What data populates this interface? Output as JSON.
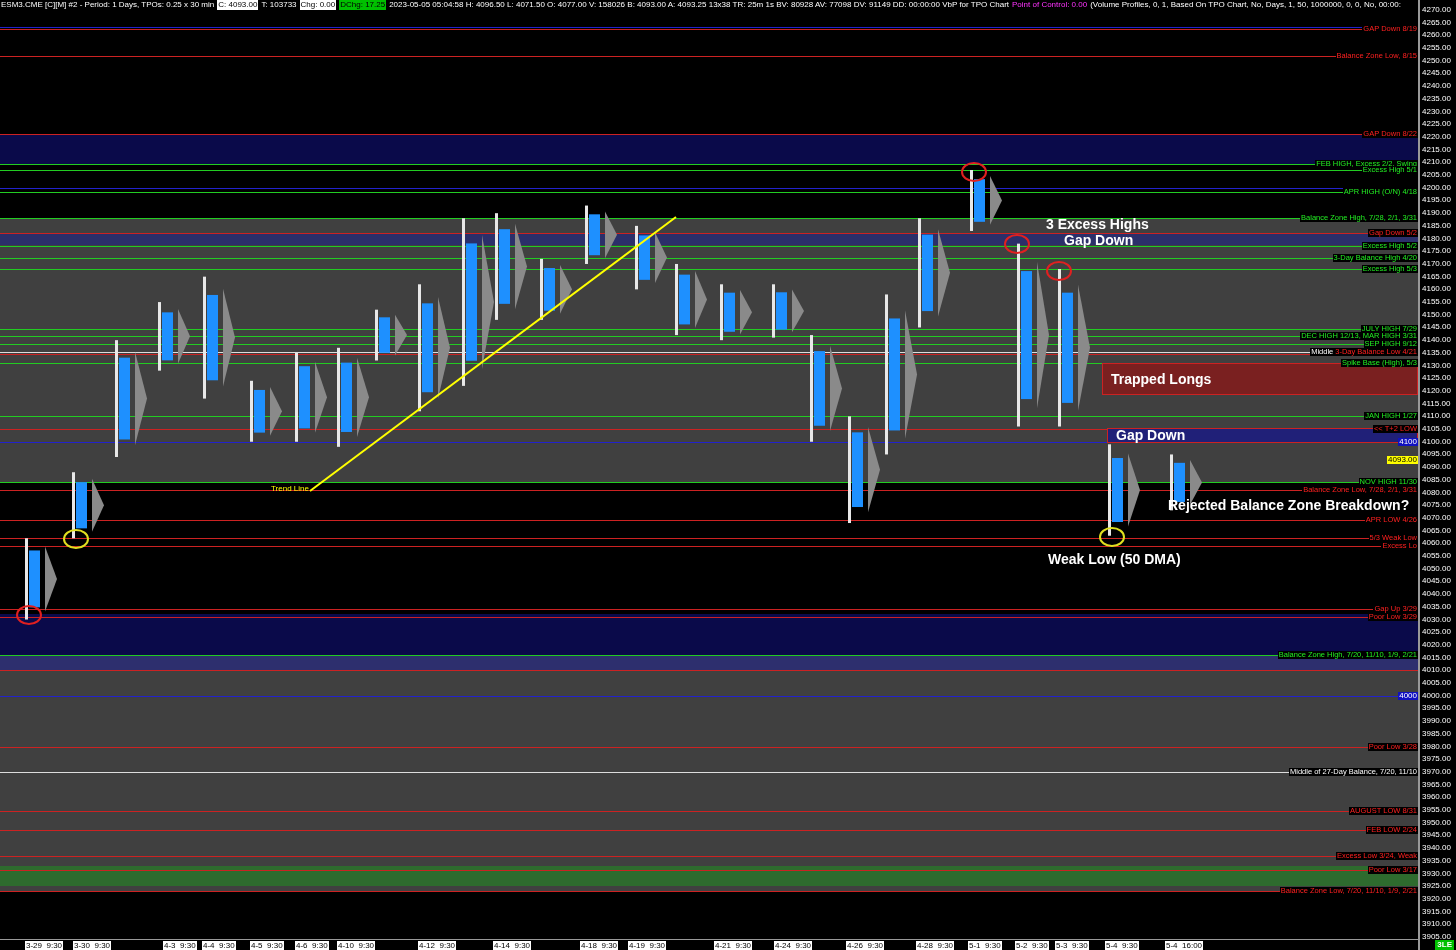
{
  "header": [
    {
      "kind": "plain",
      "text": "ESM3.CME [C][M]  #2 - Period: 1 Days, TPOs: 0.25 x 30 min"
    },
    {
      "kind": "inverse",
      "text": "C: 4093.00"
    },
    {
      "kind": "plain",
      "text": "T: 103733"
    },
    {
      "kind": "inverse",
      "text": "Chg: 0.00"
    },
    {
      "kind": "up",
      "text": "DChg: 17.25"
    },
    {
      "kind": "plain",
      "text": "2023-05-05 05:04:58 H: 4096.50 L: 4071.50 O: 4077.00 V: 158026 B: 4093.00 A: 4093.25 13x38 TR: 25m 1s BV: 80928 AV: 77098 DV: 91149 DD: 00:00:00 VbP for TPO Chart"
    },
    {
      "kind": "study",
      "text": "Point of Control: 0.00"
    },
    {
      "kind": "plain",
      "text": "(Volume Profiles, 0, 1, Based On TPO Chart, No, Days, 1, 50, 1000000, 0, 0, No, 00:00:"
    }
  ],
  "chart": {
    "price_axis": [
      "4270.00",
      "4265.00",
      "4260.00",
      "4255.00",
      "4250.00",
      "4245.00",
      "4240.00",
      "4235.00",
      "4230.00",
      "4225.00",
      "4220.00",
      "4215.00",
      "4210.00",
      "4205.00",
      "4200.00",
      "4195.00",
      "4190.00",
      "4185.00",
      "4180.00",
      "4175.00",
      "4170.00",
      "4165.00",
      "4160.00",
      "4155.00",
      "4150.00",
      "4145.00",
      "4140.00",
      "4135.00",
      "4130.00",
      "4125.00",
      "4120.00",
      "4115.00",
      "4110.00",
      "4105.00",
      "4100.00",
      "4095.00",
      "4090.00",
      "4085.00",
      "4080.00",
      "4075.00",
      "4070.00",
      "4065.00",
      "4060.00",
      "4055.00",
      "4050.00",
      "4045.00",
      "4040.00",
      "4035.00",
      "4030.00",
      "4025.00",
      "4020.00",
      "4015.00",
      "4010.00",
      "4005.00",
      "4000.00",
      "3995.00",
      "3990.00",
      "3985.00",
      "3980.00",
      "3975.00",
      "3970.00",
      "3965.00",
      "3960.00",
      "3955.00",
      "3950.00",
      "3945.00",
      "3940.00",
      "3935.00",
      "3930.00",
      "3925.00",
      "3920.00",
      "3915.00",
      "3910.00",
      "3905.00"
    ],
    "zones": [
      {
        "color": "#404040"
      },
      {
        "color": "#404040"
      },
      {
        "color": "#0a0a4a"
      },
      {
        "color": "#2b2f6a"
      },
      {
        "color": "#0a0a4a"
      },
      {
        "color": "#2d2f6e"
      },
      {
        "color": "#2e6b2e"
      }
    ],
    "levels": [
      {
        "color": "#2222cc"
      },
      {
        "color": "#cc2222",
        "label": "GAP Down 8/19"
      },
      {
        "color": "#cc2222",
        "label": "Balance Zone Low, 8/15"
      },
      {
        "color": "#cc2222",
        "label": "GAP Down 8/22"
      },
      {
        "color": "#22cc22",
        "label": "FEB HIGH, Excess 2/2, Swing"
      },
      {
        "color": "#22cc22",
        "label": "Excess High 5/1"
      },
      {
        "color": "#2222cc"
      },
      {
        "color": "#22cc22",
        "label": "APR HIGH (O/N) 4/18"
      },
      {
        "color": "#22cc22",
        "label": "Balance Zone High, 7/28, 2/1, 3/31"
      },
      {
        "color": "#cc2222",
        "label": "Gap Down 5/2"
      },
      {
        "color": "#22cc22",
        "label": "Excess High 5/2"
      },
      {
        "color": "#22cc22",
        "label": "3-Day Balance High 4/20"
      },
      {
        "color": "#22cc22",
        "label": "Excess High 5/3"
      },
      {
        "color": "#22cc22",
        "label": "JULY HIGH 7/29"
      },
      {
        "color": "#22cc22",
        "label": "DEC HIGH 12/13, MAR HIGH 3/31"
      },
      {
        "color": "#22cc22",
        "label": "SEP HIGH 9/12"
      },
      {
        "color": "#dddddd",
        "label": "Middle"
      },
      {
        "color": "#cc2222",
        "label": "3-Day Balance Low 4/21"
      },
      {
        "color": "#22cc22",
        "label": "Spike Base (High), 5/3"
      },
      {
        "color": "#22cc22",
        "label": "JAN HIGH 1/27"
      },
      {
        "color": "#cc2222",
        "label": "<< T+2 LOW"
      },
      {
        "color": "#2222cc"
      },
      {
        "color": "#22cc22",
        "label": "NOV HIGH 11/30"
      },
      {
        "color": "#cc2222",
        "label": "Balance Zone Low, 7/28, 2/1, 3/31"
      },
      {
        "color": "#cc2222",
        "label": "APR LOW 4/26"
      },
      {
        "color": "#cc2222",
        "label": "5/3 Weak Low"
      },
      {
        "color": "#cc2222",
        "label": "Excess Lo"
      },
      {
        "color": "#cc2222",
        "label": "Gap Up 3/29"
      },
      {
        "color": "#cc2222",
        "label": "Poor Low 3/29"
      },
      {
        "color": "#22cc22",
        "label": "Balance Zone High, 7/20, 11/10, 1/9, 2/21"
      },
      {
        "color": "#cc2222"
      },
      {
        "color": "#2222cc"
      },
      {
        "color": "#cc2222",
        "label": "Poor Low 3/28"
      },
      {
        "color": "#dddddd",
        "label": "Middle of 27-Day Balance, 7/20, 11/10"
      },
      {
        "color": "#cc2222",
        "label": "AUGUST LOW 8/31"
      },
      {
        "color": "#cc2222",
        "label": "FEB LOW 2/24"
      },
      {
        "color": "#cc2222",
        "label": "Excess Low 3/24, Weak"
      },
      {
        "color": "#cc2222",
        "label": "Poor Low 3/17"
      },
      {
        "color": "#cc2222",
        "label": "Balance Zone Low, 7/20, 11/10, 1/9, 2/21"
      }
    ],
    "price_tags": [
      {
        "text": "4100",
        "color": "#1010c0"
      },
      {
        "text": "4093.00",
        "color": "#ffff00"
      },
      {
        "text": "4000",
        "color": "#1010c0"
      }
    ],
    "time_axis": [
      "3-29  9:30",
      "3-30  9:30",
      "4-3  9:30",
      "4-4  9:30",
      "4-5  9:30",
      "4-6  9:30",
      "4-10  9:30",
      "4-12  9:30",
      "4-14  9:30",
      "4-18  9:30",
      "4-19  9:30",
      "4-21  9:30",
      "4-24  9:30",
      "4-26  9:30",
      "4-28  9:30",
      "5-1  9:30",
      "5-2  9:30",
      "5-3  9:30",
      "5-4  9:30",
      "5-4  16:00"
    ],
    "notes": [
      {
        "kind": "big",
        "text": "3 Excess Highs"
      },
      {
        "kind": "big",
        "text": "Gap Down"
      },
      {
        "kind": "box",
        "text": "Trapped Longs",
        "color": "#7a2020"
      },
      {
        "kind": "box",
        "text": "Gap Down",
        "color": "#202078"
      },
      {
        "kind": "big",
        "text": "Rejected Balance Zone Breakdown?"
      },
      {
        "kind": "big",
        "text": "Weak Low (50 DMA)"
      },
      {
        "kind": "small",
        "text": "Trend Line"
      }
    ]
  },
  "badge": "3LE"
}
